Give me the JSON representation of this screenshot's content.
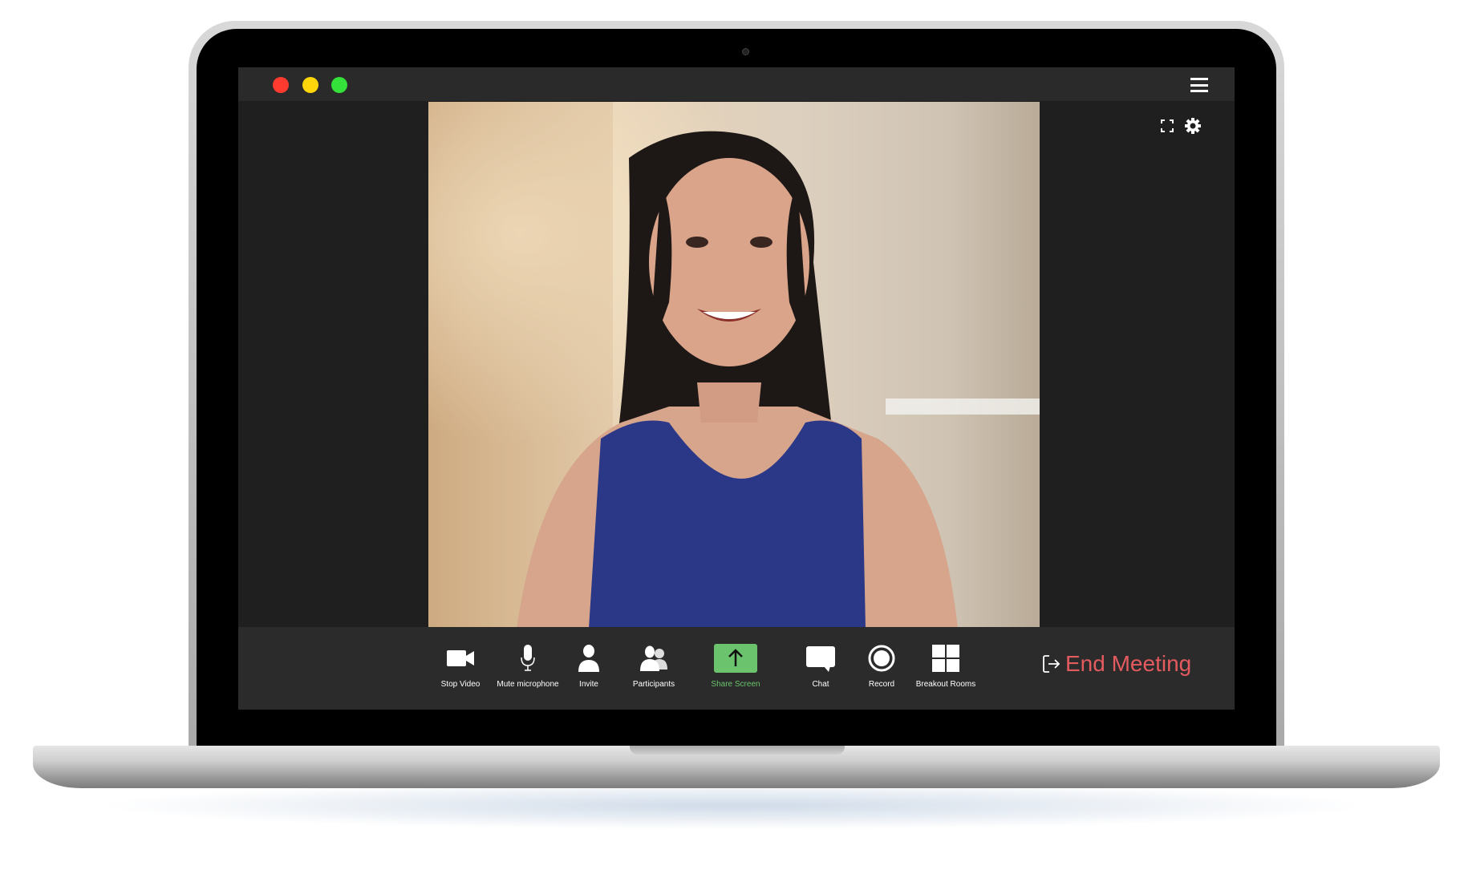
{
  "window": {
    "traffic_lights": {
      "close": "#ff3b30",
      "minimize": "#ffd60a",
      "maximize": "#34e03a"
    },
    "menu_icon": "hamburger-icon"
  },
  "video": {
    "top_icons": [
      "fullscreen-icon",
      "gear-icon"
    ]
  },
  "toolbar": {
    "items": [
      {
        "label": "Stop Video",
        "icon": "video-camera-icon"
      },
      {
        "label": "Mute microphone",
        "icon": "microphone-icon"
      },
      {
        "label": "Invite",
        "icon": "person-icon"
      },
      {
        "label": "Participants",
        "icon": "people-icon"
      },
      {
        "label": "Share Screen",
        "icon": "share-screen-icon"
      },
      {
        "label": "Chat",
        "icon": "chat-icon"
      },
      {
        "label": "Record",
        "icon": "record-icon"
      },
      {
        "label": "Breakout Rooms",
        "icon": "grid-icon"
      }
    ],
    "end_meeting": "End Meeting"
  },
  "colors": {
    "share_green": "#6bc46d",
    "end_red": "#e35a5f",
    "toolbar_bg": "#2b2b2b",
    "stage_bg": "#1f1f1f"
  }
}
